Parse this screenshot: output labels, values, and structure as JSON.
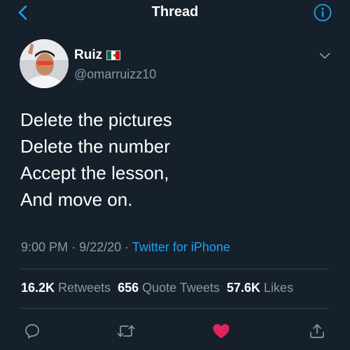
{
  "header": {
    "title": "Thread",
    "back_icon": "chevron-left-icon",
    "info_icon": "info-circle-icon"
  },
  "author": {
    "name": "Ruiz",
    "flag_icon": "mexico-flag-icon",
    "handle": "@omarruizz10"
  },
  "tweet": {
    "lines": [
      "Delete the pictures",
      "Delete the number",
      "Accept the lesson,",
      "And move on."
    ]
  },
  "meta": {
    "time": "9:00 PM",
    "separator": "·",
    "date": "9/22/20",
    "source": "Twitter for iPhone"
  },
  "stats": {
    "retweets_count": "16.2K",
    "retweets_label": "Retweets",
    "quotes_count": "656",
    "quotes_label": "Quote Tweets",
    "likes_count": "57.6K",
    "likes_label": "Likes"
  },
  "actions": {
    "reply_icon": "reply-icon",
    "retweet_icon": "retweet-icon",
    "like_icon": "heart-icon",
    "share_icon": "share-icon"
  },
  "colors": {
    "background": "#15202b",
    "accent": "#1da1f2",
    "secondary_text": "#8899a6",
    "like": "#e0245e",
    "divider": "#38444d"
  }
}
